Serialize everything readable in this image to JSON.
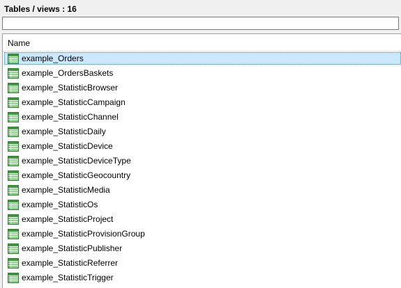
{
  "header": {
    "title": "Tables / views : 16"
  },
  "filter": {
    "value": "",
    "placeholder": ""
  },
  "list": {
    "column_header": "Name",
    "icon": "table-grid-icon",
    "icon_color": "#3c9a3c",
    "selected_index": 0,
    "items": [
      {
        "label": "example_Orders"
      },
      {
        "label": "example_OrdersBaskets"
      },
      {
        "label": "example_StatisticBrowser"
      },
      {
        "label": "example_StatisticCampaign"
      },
      {
        "label": "example_StatisticChannel"
      },
      {
        "label": "example_StatisticDaily"
      },
      {
        "label": "example_StatisticDevice"
      },
      {
        "label": "example_StatisticDeviceType"
      },
      {
        "label": "example_StatisticGeocountry"
      },
      {
        "label": "example_StatisticMedia"
      },
      {
        "label": "example_StatisticOs"
      },
      {
        "label": "example_StatisticProject"
      },
      {
        "label": "example_StatisticProvisionGroup"
      },
      {
        "label": "example_StatisticPublisher"
      },
      {
        "label": "example_StatisticReferrer"
      },
      {
        "label": "example_StatisticTrigger"
      }
    ]
  }
}
